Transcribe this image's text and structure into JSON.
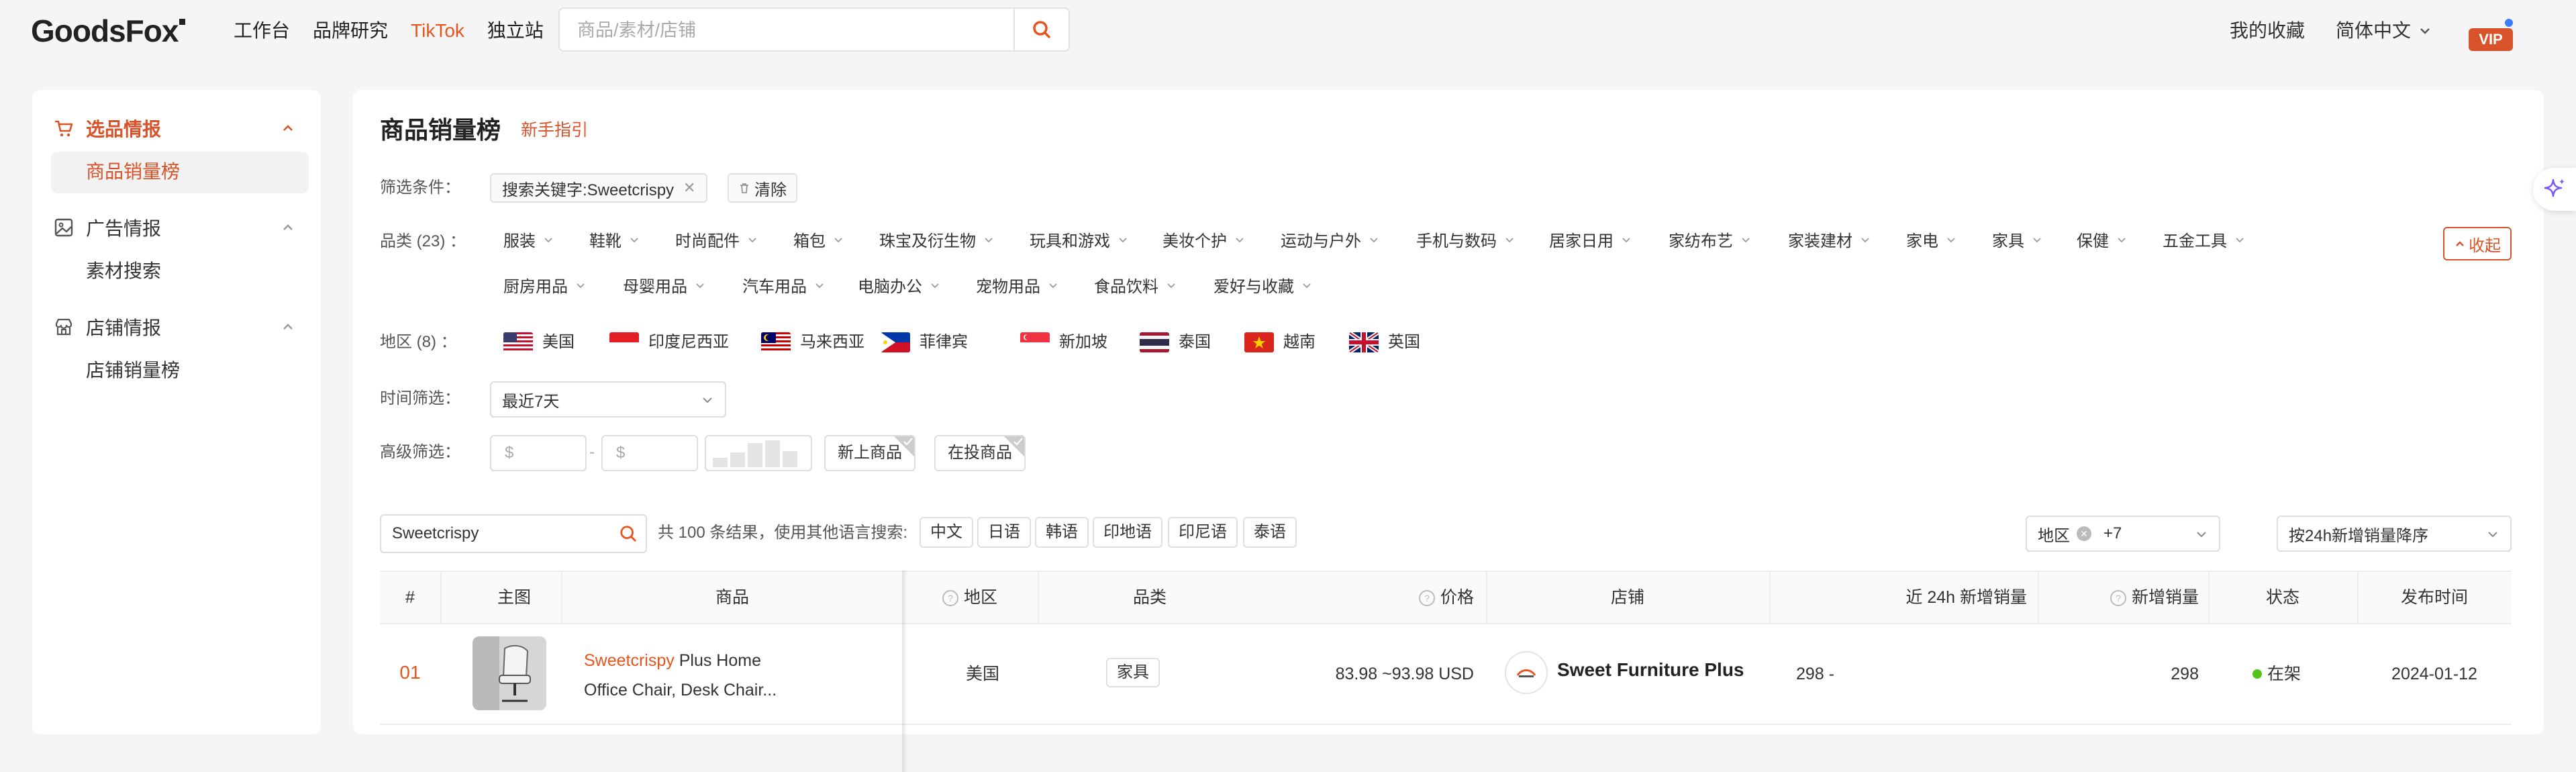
{
  "header": {
    "logo": "GoodsFox",
    "nav": [
      "工作台",
      "品牌研究",
      "TikTok",
      "独立站"
    ],
    "nav_active_index": 2,
    "search_placeholder": "商品/素材/店铺",
    "favorites": "我的收藏",
    "language": "简体中文",
    "vip": "VIP"
  },
  "sidebar": {
    "sections": [
      {
        "label": "选品情报",
        "active": true,
        "items": [
          "商品销量榜"
        ]
      },
      {
        "label": "广告情报",
        "active": false,
        "items": [
          "素材搜索"
        ]
      },
      {
        "label": "店铺情报",
        "active": false,
        "items": [
          "店铺销量榜"
        ]
      }
    ]
  },
  "main": {
    "title": "商品销量榜",
    "guide": "新手指引",
    "filters": {
      "label": "筛选条件：",
      "active_tag": "搜索关键字:Sweetcrispy",
      "clear": "清除"
    },
    "categories": {
      "label": "品类 (23) ：",
      "row1": [
        "服装",
        "鞋靴",
        "时尚配件",
        "箱包",
        "珠宝及衍生物",
        "玩具和游戏",
        "美妆个护",
        "运动与户外",
        "手机与数码",
        "居家日用",
        "家纺布艺",
        "家装建材",
        "家电",
        "家具",
        "保健",
        "五金工具"
      ],
      "row2": [
        "厨房用品",
        "母婴用品",
        "汽车用品",
        "电脑办公",
        "宠物用品",
        "食品饮料",
        "爱好与收藏"
      ],
      "collapse": "收起"
    },
    "regions": {
      "label": "地区 (8) ：",
      "items": [
        "美国",
        "印度尼西亚",
        "马来西亚",
        "菲律宾",
        "新加坡",
        "泰国",
        "越南",
        "英国"
      ]
    },
    "time_filter": {
      "label": "时间筛选：",
      "value": "最近7天"
    },
    "advanced": {
      "label": "高级筛选：",
      "min_placeholder": "$",
      "max_placeholder": "$",
      "dash": "-",
      "new_products": "新上商品",
      "active_ads": "在投商品"
    },
    "search": {
      "value": "Sweetcrispy",
      "result_text": "共 100 条结果，使用其他语言搜索:",
      "languages": [
        "中文",
        "日语",
        "韩语",
        "印地语",
        "印尼语",
        "泰语"
      ],
      "region_select": "地区",
      "region_more": "+7",
      "sort": "按24h新增销量降序"
    },
    "table": {
      "columns": [
        "#",
        "主图",
        "商品",
        "地区",
        "品类",
        "价格",
        "店铺",
        "近 24h 新增销量",
        "新增销量",
        "状态",
        "发布时间"
      ],
      "rows": [
        {
          "rank": "01",
          "title_highlight": "Sweetcrispy",
          "title_rest": " Plus Home",
          "title_line2": "Office Chair, Desk Chair...",
          "region": "美国",
          "category": "家具",
          "price": "83.98 ~93.98 USD",
          "store": "Sweet Furniture Plus",
          "sales_24h": "298 -",
          "new_sales": "298",
          "status": "在架",
          "date": "2024-01-12"
        }
      ]
    }
  },
  "colors": {
    "accent": "#d9532a",
    "status_green": "#52c41a"
  }
}
